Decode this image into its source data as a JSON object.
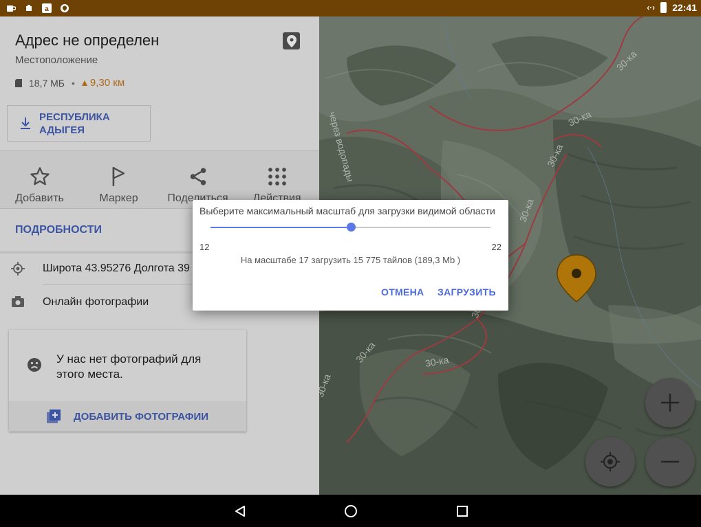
{
  "status_bar": {
    "time": "22:41",
    "left_icons": [
      "coffee-icon",
      "app-icon",
      "amazon-icon",
      "vpn-icon"
    ],
    "right_icons": [
      "code-icon",
      "battery-charging-icon"
    ]
  },
  "place": {
    "title": "Адрес не определен",
    "subtitle": "Местоположение",
    "size": "18,7 МБ",
    "separator": "•",
    "distance": "9,30 км",
    "region_button": "РЕСПУБЛИКА АДЫГЕЯ"
  },
  "actions": [
    {
      "label": "Добавить",
      "icon": "star-icon"
    },
    {
      "label": "Маркер",
      "icon": "flag-icon"
    },
    {
      "label": "Поделиться",
      "icon": "share-icon"
    },
    {
      "label": "Действия",
      "icon": "grid-icon"
    }
  ],
  "details_tab": "ПОДРОБНОСТИ",
  "rows": [
    {
      "text": "Широта 43.95276 Долгота 39",
      "icon": "location-icon"
    },
    {
      "text": "Онлайн фотографии",
      "icon": "camera-icon"
    }
  ],
  "photos_card": {
    "message": "У нас нет фотографий для этого места.",
    "add_label": "ДОБАВИТЬ ФОТОГРАФИИ"
  },
  "map": {
    "trail_label": "30-ка",
    "river_label": "через водопады",
    "marker_color": "#c8860a",
    "trail_color": "#b2444b"
  },
  "dialog": {
    "title": "Выберите максимальный масштаб для загрузки видимой области",
    "min": "12",
    "max": "22",
    "slider_fraction": 0.5,
    "info": "На масштабе 17 загрузить 15 775 тайлов (189,3 Mb )",
    "cancel": "ОТМЕНА",
    "confirm": "ЗАГРУЗИТЬ"
  },
  "colors": {
    "accent": "#4560b8",
    "status_bar": "#6e4105",
    "slider": "#5b78e6"
  }
}
